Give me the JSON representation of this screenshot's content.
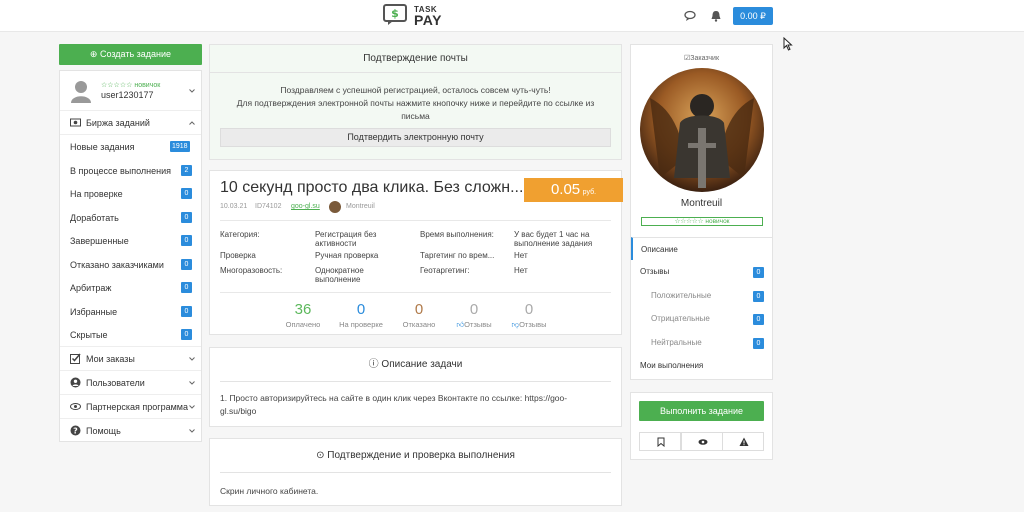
{
  "header": {
    "logo_top": "TASK",
    "logo_bottom": "PAY",
    "balance": "0.00 ₽"
  },
  "sidebar": {
    "create_label": "Создать задание",
    "user": {
      "rank": "☆☆☆☆☆ новичок",
      "name": "user1230177"
    },
    "exchange_label": "Биржа заданий",
    "items": [
      {
        "label": "Новые задания",
        "count": "1918"
      },
      {
        "label": "В процессе выполнения",
        "count": "2"
      },
      {
        "label": "На проверке",
        "count": "0"
      },
      {
        "label": "Доработать",
        "count": "0"
      },
      {
        "label": "Завершенные",
        "count": "0"
      },
      {
        "label": "Отказано заказчиками",
        "count": "0"
      },
      {
        "label": "Арбитраж",
        "count": "0"
      },
      {
        "label": "Избранные",
        "count": "0"
      },
      {
        "label": "Скрытые",
        "count": "0"
      }
    ],
    "sections": [
      {
        "label": "Мои заказы"
      },
      {
        "label": "Пользователи"
      },
      {
        "label": "Партнерская программа"
      },
      {
        "label": "Помощь"
      }
    ]
  },
  "email_confirm": {
    "title": "Подтверждение почты",
    "line1": "Поздравляем с успешной регистрацией, осталось совсем чуть-чуть!",
    "line2": "Для подтверждения электронной почты нажмите кнопочку ниже и перейдите по ссылке из",
    "line3": "письма",
    "button": "Подтвердить электронную почту"
  },
  "task": {
    "title": "10 секунд просто два клика. Без сложн...",
    "price": "0.05",
    "currency": "руб.",
    "date": "10.03.21",
    "id": "ID74102",
    "domain": "goo-gl.su",
    "author": "Montreuil",
    "details": {
      "category_label": "Категория:",
      "category_value_1": "Регистрация без",
      "category_value_2": "активности",
      "check_label": "Проверка",
      "check_value": "Ручная проверка",
      "reuse_label": "Многоразовость:",
      "reuse_value_1": "Однократное",
      "reuse_value_2": "выполнение",
      "time_label": "Время выполнения:",
      "time_value_1": "У вас будет 1 час на",
      "time_value_2": "выполнение задания",
      "targeting_label": "Таргетинг по врем...",
      "targeting_value": "Нет",
      "geo_label": "Геотаргетинг:",
      "geo_value": "Нет"
    },
    "stats": [
      {
        "value": "36",
        "label": "Оплачено",
        "color": "#5cb85c"
      },
      {
        "value": "0",
        "label": "На проверке",
        "color": "#2b8cdc"
      },
      {
        "value": "0",
        "label": "Отказано",
        "color": "#b07a4a"
      },
      {
        "value": "0",
        "label": "Отзывы",
        "color": "#aaaaaa"
      },
      {
        "value": "0",
        "label": "Отзывы",
        "color": "#aaaaaa"
      }
    ]
  },
  "description": {
    "title": "Описание задачи",
    "line1": "1. Просто авторизируйтесь на сайте в один клик через Вконтакте по ссылке: https://goo-",
    "line2": "gl.su/bigo"
  },
  "confirmation": {
    "title": "Подтверждение и проверка выполнения",
    "body": "Скрин личного кабинета."
  },
  "customer": {
    "label": "Заказчик",
    "name": "Montreuil",
    "rank": "☆☆☆☆☆ новичок",
    "tabs": [
      {
        "label": "Описание",
        "count": ""
      },
      {
        "label": "Отзывы",
        "count": "0"
      },
      {
        "label": "Положительные",
        "count": "0"
      },
      {
        "label": "Отрицательные",
        "count": "0"
      },
      {
        "label": "Нейтральные",
        "count": "0"
      },
      {
        "label": "Мои выполнения",
        "count": ""
      }
    ]
  },
  "actions": {
    "do_task": "Выполнить задание"
  },
  "colors": {
    "green": "#4caf50",
    "blue": "#2b8cdc",
    "orange": "#f0a030"
  }
}
